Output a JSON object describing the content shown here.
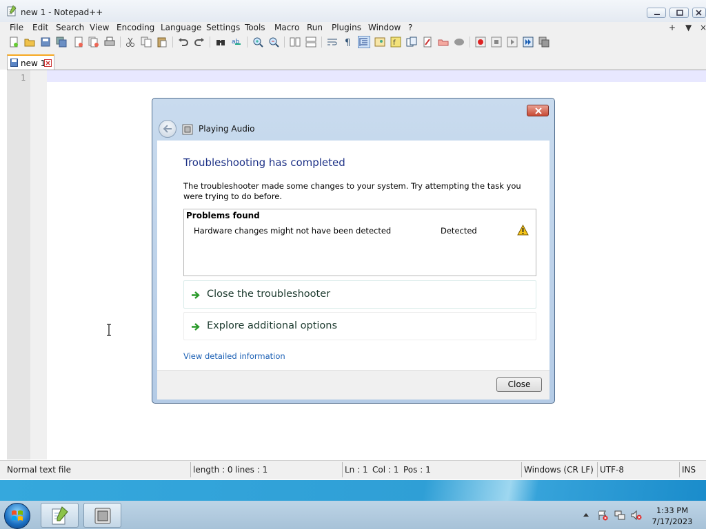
{
  "window": {
    "title": "new 1 - Notepad++"
  },
  "menu": {
    "items": [
      "File",
      "Edit",
      "Search",
      "View",
      "Encoding",
      "Language",
      "Settings",
      "Tools",
      "Macro",
      "Run",
      "Plugins",
      "Window",
      "?"
    ],
    "right": [
      "+",
      "▼",
      "×"
    ]
  },
  "toolbar": {
    "icons": [
      "new-file-icon",
      "open-file-icon",
      "save-icon",
      "save-all-icon",
      "close-icon",
      "close-all-icon",
      "print-icon",
      "cut-icon",
      "copy-icon",
      "paste-icon",
      "undo-icon",
      "redo-icon",
      "find-icon",
      "replace-icon",
      "zoom-in-icon",
      "zoom-out-icon",
      "sync-vertical-icon",
      "sync-horizontal-icon",
      "word-wrap-icon",
      "show-all-chars-icon",
      "indent-guide-icon",
      "doc-map-icon",
      "function-list-icon",
      "folder-workspace-icon",
      "monitoring-icon",
      "record-macro-icon",
      "stop-macro-icon",
      "play-macro-icon",
      "run-macro-multiple-icon",
      "save-macro-icon"
    ]
  },
  "tab": {
    "label": "new 1"
  },
  "editor": {
    "line_number": "1"
  },
  "statusbar": {
    "file_type": "Normal text file",
    "length": "length : 0",
    "lines": "lines : 1",
    "ln": "Ln : 1",
    "col": "Col : 1",
    "pos": "Pos : 1",
    "eol": "Windows (CR LF)",
    "encoding": "UTF-8",
    "mode": "INS"
  },
  "dialog": {
    "title": "Playing Audio",
    "heading": "Troubleshooting has completed",
    "description": "The troubleshooter made some changes to your system. Try attempting the task you were trying to do before.",
    "problems_header": "Problems found",
    "problems": [
      {
        "text": "Hardware changes might not have been detected",
        "status": "Detected",
        "icon": "warning-icon"
      }
    ],
    "options": [
      {
        "label": "Close the troubleshooter"
      },
      {
        "label": "Explore additional options"
      }
    ],
    "detail_link": "View detailed information",
    "close_button": "Close"
  },
  "taskbar": {
    "time": "1:33 PM",
    "date": "7/17/2023",
    "pinned": [
      "notepadpp-icon",
      "troubleshooter-icon"
    ],
    "tray": [
      "show-hidden-icons-icon",
      "action-center-icon",
      "network-icon",
      "volume-muted-icon"
    ]
  },
  "colors": {
    "heading": "#1e3287",
    "link": "#1a5fb4",
    "tab_accent": "#f6a81f",
    "current_line": "#e8e8ff"
  }
}
